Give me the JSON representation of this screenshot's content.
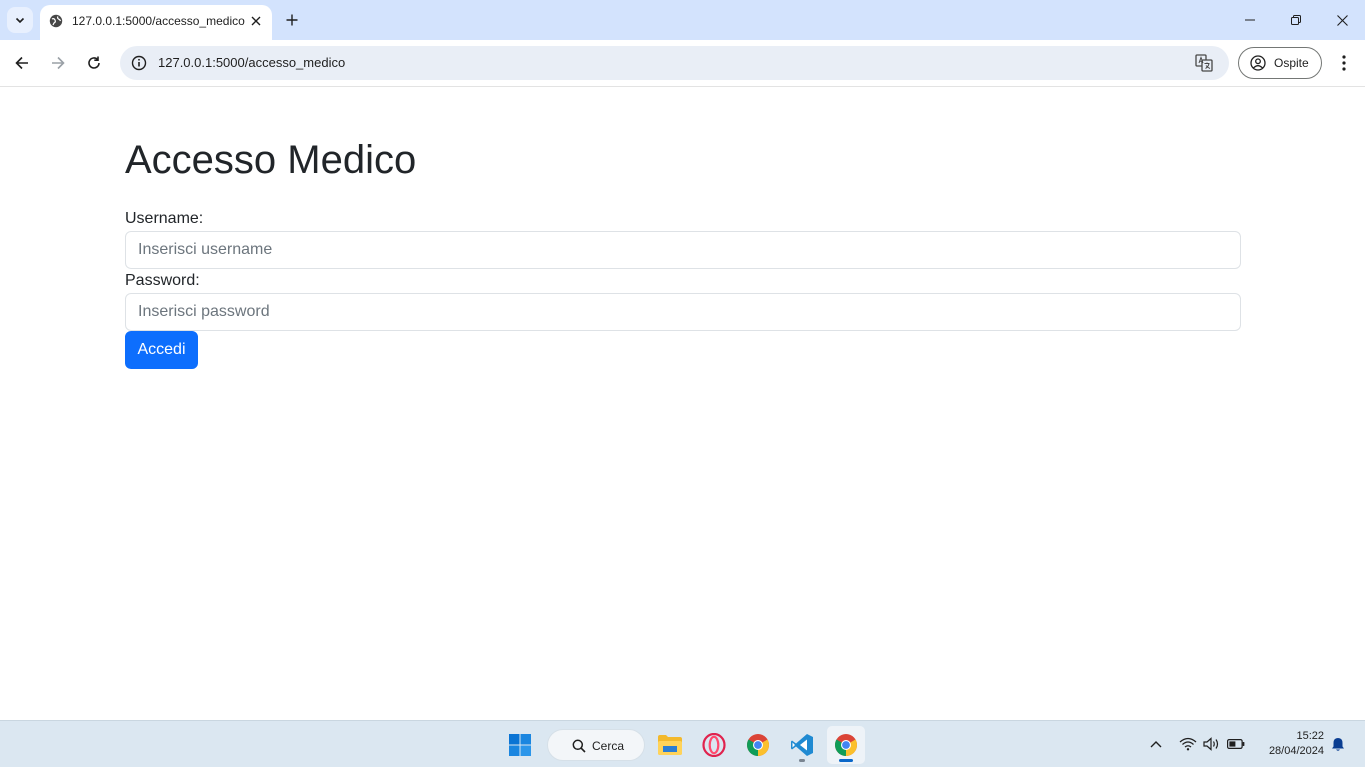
{
  "browser": {
    "tab_title": "127.0.0.1:5000/accesso_medico",
    "url": "127.0.0.1:5000/accesso_medico",
    "profile_label": "Ospite"
  },
  "page": {
    "title": "Accesso Medico",
    "username_label": "Username:",
    "username_placeholder": "Inserisci username",
    "password_label": "Password:",
    "password_placeholder": "Inserisci password",
    "submit_label": "Accedi"
  },
  "taskbar": {
    "search_label": "Cerca",
    "time": "15:22",
    "date": "28/04/2024",
    "apps": [
      "start-icon",
      "file-explorer-icon",
      "opera-icon",
      "chrome-icon",
      "vscode-icon",
      "chrome-active-icon"
    ]
  },
  "colors": {
    "primary": "#0d6efd",
    "tabstrip": "#d3e3fd",
    "omnibox": "#e9eef6",
    "taskbar": "#dbe7f1"
  }
}
